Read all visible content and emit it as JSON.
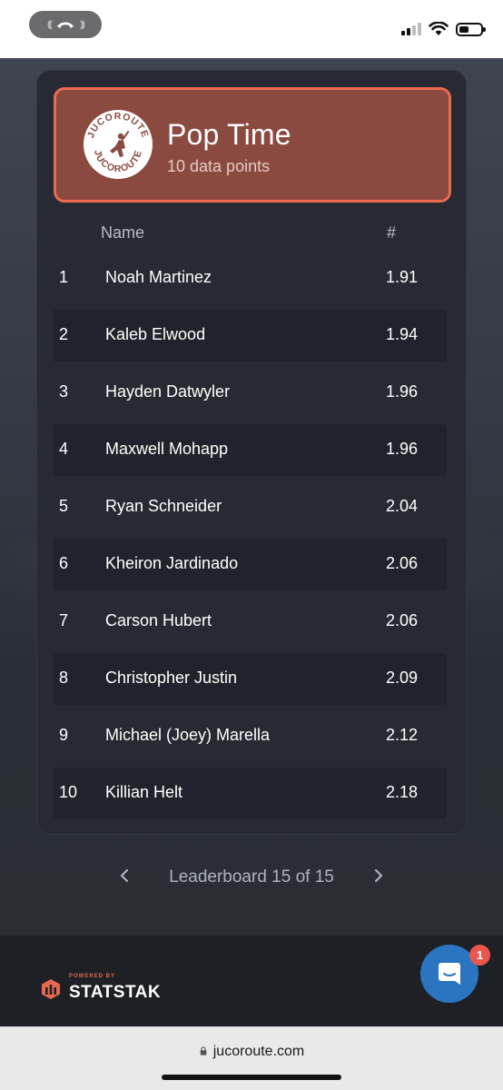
{
  "board": {
    "title": "Pop Time",
    "subtitle": "10 data points",
    "col_name": "Name",
    "col_value": "#",
    "logo_text": "JUCOROUTE"
  },
  "players": [
    {
      "rank": "1",
      "name": "Noah Martinez",
      "value": "1.91"
    },
    {
      "rank": "2",
      "name": "Kaleb Elwood",
      "value": "1.94"
    },
    {
      "rank": "3",
      "name": "Hayden Datwyler",
      "value": "1.96"
    },
    {
      "rank": "4",
      "name": "Maxwell Mohapp",
      "value": "1.96"
    },
    {
      "rank": "5",
      "name": "Ryan Schneider",
      "value": "2.04"
    },
    {
      "rank": "6",
      "name": "Kheiron Jardinado",
      "value": "2.06"
    },
    {
      "rank": "7",
      "name": "Carson Hubert",
      "value": "2.06"
    },
    {
      "rank": "8",
      "name": "Christopher Justin",
      "value": "2.09"
    },
    {
      "rank": "9",
      "name": "Michael (Joey) Marella",
      "value": "2.12"
    },
    {
      "rank": "10",
      "name": "Killian Helt",
      "value": "2.18"
    }
  ],
  "pager": {
    "label": "Leaderboard 15 of 15"
  },
  "footer": {
    "powered_by": "POWERED BY",
    "brand": "STATSTAK"
  },
  "chat": {
    "badge_count": "1"
  },
  "browser": {
    "url": "jucoroute.com"
  },
  "colors": {
    "accent": "#ea6a4d",
    "header_fill": "#8b4a40",
    "card": "#272a33",
    "chat": "#2b74c0"
  },
  "icons": {
    "call": "phone-call-icon",
    "signal": "cellular-signal-icon",
    "wifi": "wifi-icon",
    "battery": "battery-icon",
    "prev": "chevron-left-icon",
    "next": "chevron-right-icon",
    "chat": "chat-bubble-icon",
    "lock": "lock-icon"
  }
}
